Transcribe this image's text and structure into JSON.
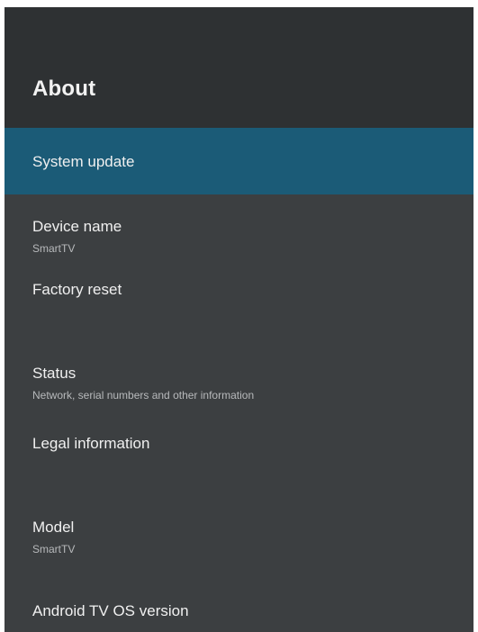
{
  "header": {
    "title": "About"
  },
  "items": [
    {
      "title": "System update",
      "selected": true
    },
    {
      "title": "Device name",
      "subtitle": "SmartTV"
    },
    {
      "title": "Factory reset"
    },
    {
      "title": "Status",
      "subtitle": "Network, serial numbers and other information"
    },
    {
      "title": "Legal information"
    },
    {
      "title": "Model",
      "subtitle": "SmartTV"
    },
    {
      "title": "Android TV OS version"
    }
  ],
  "colors": {
    "header_bg": "#2e3133",
    "list_bg": "#3c3f41",
    "selected_bg": "#1b5b77"
  }
}
